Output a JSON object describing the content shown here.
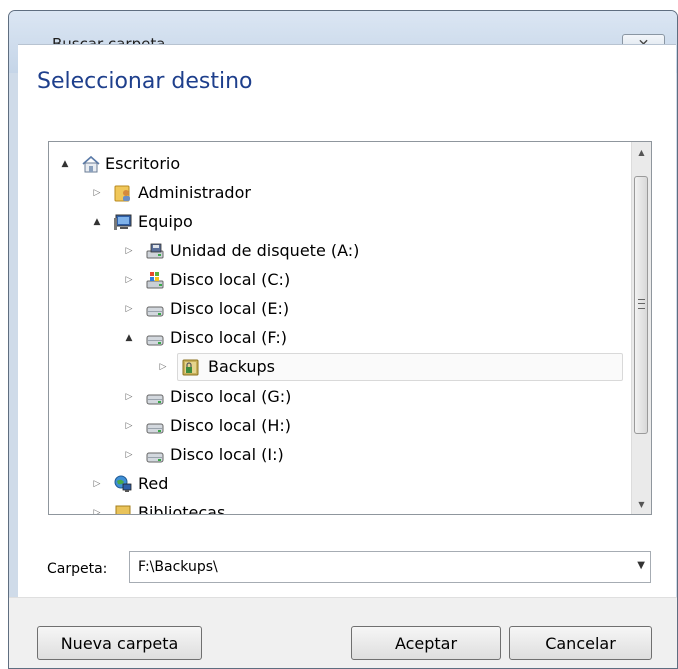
{
  "window": {
    "title": "Buscar carpeta",
    "close_glyph": "✕"
  },
  "heading": "Seleccionar destino",
  "tree": {
    "items": [
      {
        "label": "Escritorio",
        "icon": "home-desktop-icon",
        "expander": "▲"
      },
      {
        "label": "Administrador",
        "icon": "user-folder-icon",
        "expander": "▷"
      },
      {
        "label": "Equipo",
        "icon": "computer-icon",
        "expander": "▲"
      },
      {
        "label": "Unidad de disquete (A:)",
        "icon": "floppy-drive-icon",
        "expander": "▷"
      },
      {
        "label": "Disco local (C:)",
        "icon": "windows-drive-icon",
        "expander": "▷"
      },
      {
        "label": "Disco local (E:)",
        "icon": "hard-drive-icon",
        "expander": "▷"
      },
      {
        "label": "Disco local (F:)",
        "icon": "hard-drive-icon",
        "expander": "▲"
      },
      {
        "label": "Backups",
        "icon": "locked-folder-icon",
        "expander": "▷",
        "selected": true
      },
      {
        "label": "Disco local (G:)",
        "icon": "hard-drive-icon",
        "expander": "▷"
      },
      {
        "label": "Disco local (H:)",
        "icon": "hard-drive-icon",
        "expander": "▷"
      },
      {
        "label": "Disco local (I:)",
        "icon": "hard-drive-icon",
        "expander": "▷"
      },
      {
        "label": "Red",
        "icon": "network-icon",
        "expander": "▷"
      },
      {
        "label": "Bibliotecas",
        "icon": "library-icon",
        "expander": "▷"
      }
    ]
  },
  "folder": {
    "label": "Carpeta:",
    "value": "F:\\Backups\\",
    "dropdown_glyph": "▼"
  },
  "buttons": {
    "new_folder": "Nueva carpeta",
    "ok": "Aceptar",
    "cancel": "Cancelar"
  },
  "colors": {
    "heading": "#1e3f8c",
    "chrome": "#cfdbe9"
  }
}
